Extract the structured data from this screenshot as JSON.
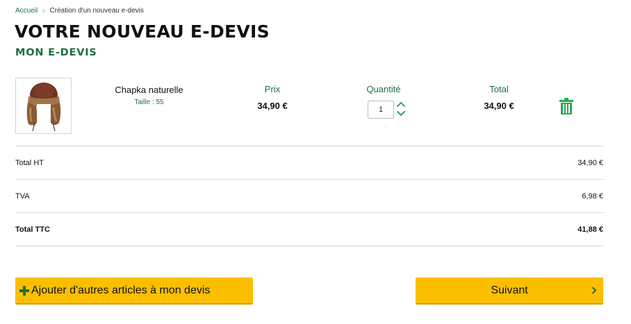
{
  "breadcrumb": {
    "home": "Accueil",
    "separator": ">",
    "current": "Création d'un nouveau e-devis"
  },
  "page_title": "VOTRE NOUVEAU E-DEVIS",
  "section_title": "MON E-DEVIS",
  "product": {
    "image_icon": "hat-product-icon",
    "name": "Chapka naturelle",
    "size": "Taille : 55",
    "price_header": "Prix",
    "price": "34,90 €",
    "quantity_header": "Quantité",
    "quantity": "1",
    "total_header": "Total",
    "total": "34,90 €",
    "delete_icon": "trash-icon"
  },
  "summary": {
    "total_ht_label": "Total HT",
    "total_ht": "34,90 €",
    "tva_label": "TVA",
    "tva": "6,98 €",
    "total_ttc_label": "Total TTC",
    "total_ttc": "41,88 €"
  },
  "buttons": {
    "add_more": "Ajouter d'autres articles à mon devis",
    "next": "Suivant"
  },
  "colors": {
    "brand_green": "#1e6f3d",
    "accent_green": "#2fa85a",
    "button_yellow": "#fbbf00"
  }
}
